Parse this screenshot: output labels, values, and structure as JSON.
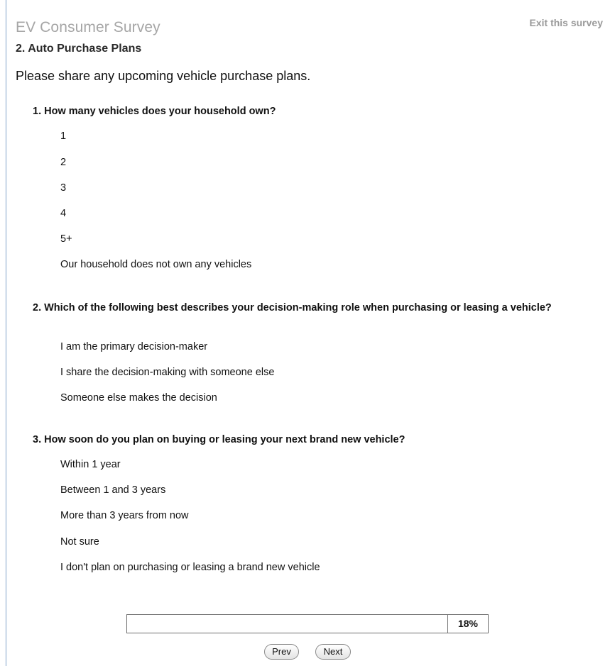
{
  "header": {
    "survey_title": "EV Consumer Survey",
    "exit_link": "Exit this survey",
    "page_title": "2. Auto Purchase Plans",
    "intro": "Please share any upcoming vehicle purchase plans."
  },
  "questions": [
    {
      "text": "1. How many vehicles does your household own?",
      "options": [
        "1",
        "2",
        "3",
        "4",
        "5+",
        "Our household does not own any vehicles"
      ]
    },
    {
      "text": "2. Which of the following best describes your decision-making role when purchasing or leasing a vehicle?",
      "options": [
        "I am the primary decision-maker",
        "I share the decision-making with someone else",
        "Someone else makes the decision"
      ]
    },
    {
      "text": "3. How soon do you plan on buying or leasing your next brand new vehicle?",
      "options": [
        "Within 1 year",
        "Between 1 and 3 years",
        "More than 3 years from now",
        "Not sure",
        "I don't plan on purchasing or leasing a brand new vehicle"
      ]
    }
  ],
  "progress": {
    "percent_label": "18%",
    "fraction": 0.18
  },
  "nav": {
    "prev_label": "Prev",
    "next_label": "Next"
  }
}
